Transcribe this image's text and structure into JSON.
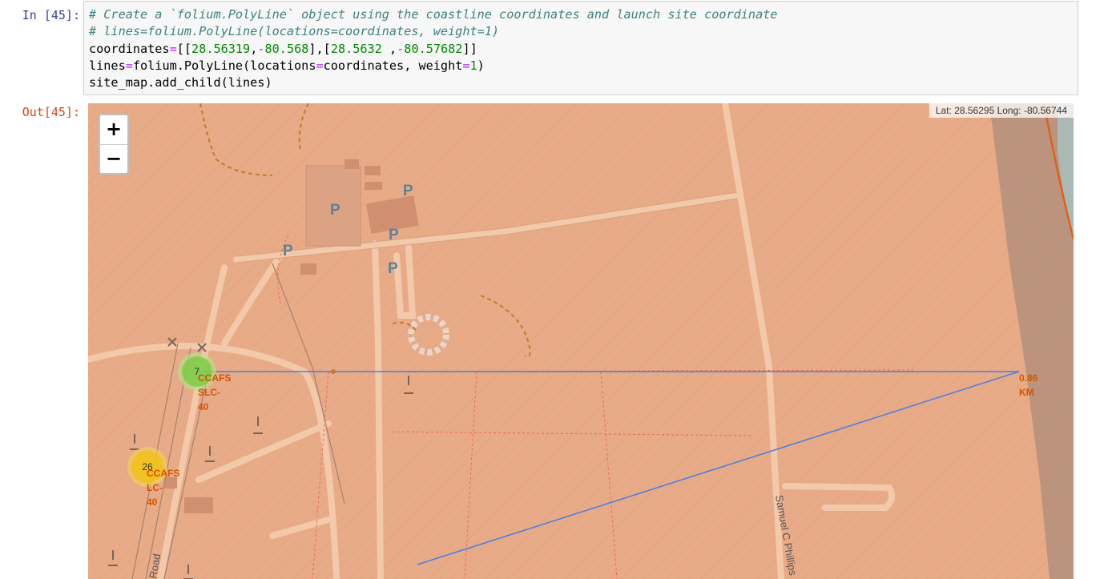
{
  "cell": {
    "in_prompt": "In [45]:",
    "out_prompt": "Out[45]:",
    "code_lines": [
      [
        {
          "t": "comment",
          "v": "# Create a `folium.PolyLine` object using the coastline coordinates and launch site coordinate"
        }
      ],
      [
        {
          "t": "comment",
          "v": "# lines=folium.PolyLine(locations=coordinates, weight=1)"
        }
      ],
      [
        {
          "t": "text",
          "v": "coordinates"
        },
        {
          "t": "op",
          "v": "="
        },
        {
          "t": "text",
          "v": "[["
        },
        {
          "t": "num",
          "v": "28.56319"
        },
        {
          "t": "text",
          "v": ","
        },
        {
          "t": "op",
          "v": "-"
        },
        {
          "t": "num",
          "v": "80.568"
        },
        {
          "t": "text",
          "v": "],["
        },
        {
          "t": "num",
          "v": "28.5632"
        },
        {
          "t": "text",
          "v": " ,"
        },
        {
          "t": "op",
          "v": "-"
        },
        {
          "t": "num",
          "v": "80.57682"
        },
        {
          "t": "text",
          "v": "]]"
        }
      ],
      [
        {
          "t": "text",
          "v": "lines"
        },
        {
          "t": "op",
          "v": "="
        },
        {
          "t": "text",
          "v": "folium.PolyLine(locations"
        },
        {
          "t": "op",
          "v": "="
        },
        {
          "t": "text",
          "v": "coordinates, weight"
        },
        {
          "t": "op",
          "v": "="
        },
        {
          "t": "num",
          "v": "1"
        },
        {
          "t": "text",
          "v": ")"
        }
      ],
      [
        {
          "t": "text",
          "v": "site_map.add_child(lines)"
        }
      ]
    ],
    "colors": {
      "comment": "#408080",
      "op": "#aa22ff",
      "num": "#008800",
      "in_prompt": "#303f9f",
      "out_prompt": "#d84315"
    }
  },
  "map": {
    "zoom_in_label": "+",
    "zoom_out_label": "−",
    "mouse_position": "Lat: 28.56295 Long: -80.56744",
    "clusters": [
      {
        "count": "7",
        "label": "CCAFS\nSLC-\n40",
        "color": "#6ecc39"
      },
      {
        "count": "26",
        "label": "CCAFS\nLC-\n40",
        "color": "#f0c20c"
      }
    ],
    "distance_label": "0.86\nKM",
    "parking_symbol": "P",
    "road_names": [
      "Samuel C Phillips",
      "Road"
    ],
    "polyline_color": "#4c7de0",
    "land_color": "#e8ab88",
    "sea_color": "#aab9b4"
  }
}
